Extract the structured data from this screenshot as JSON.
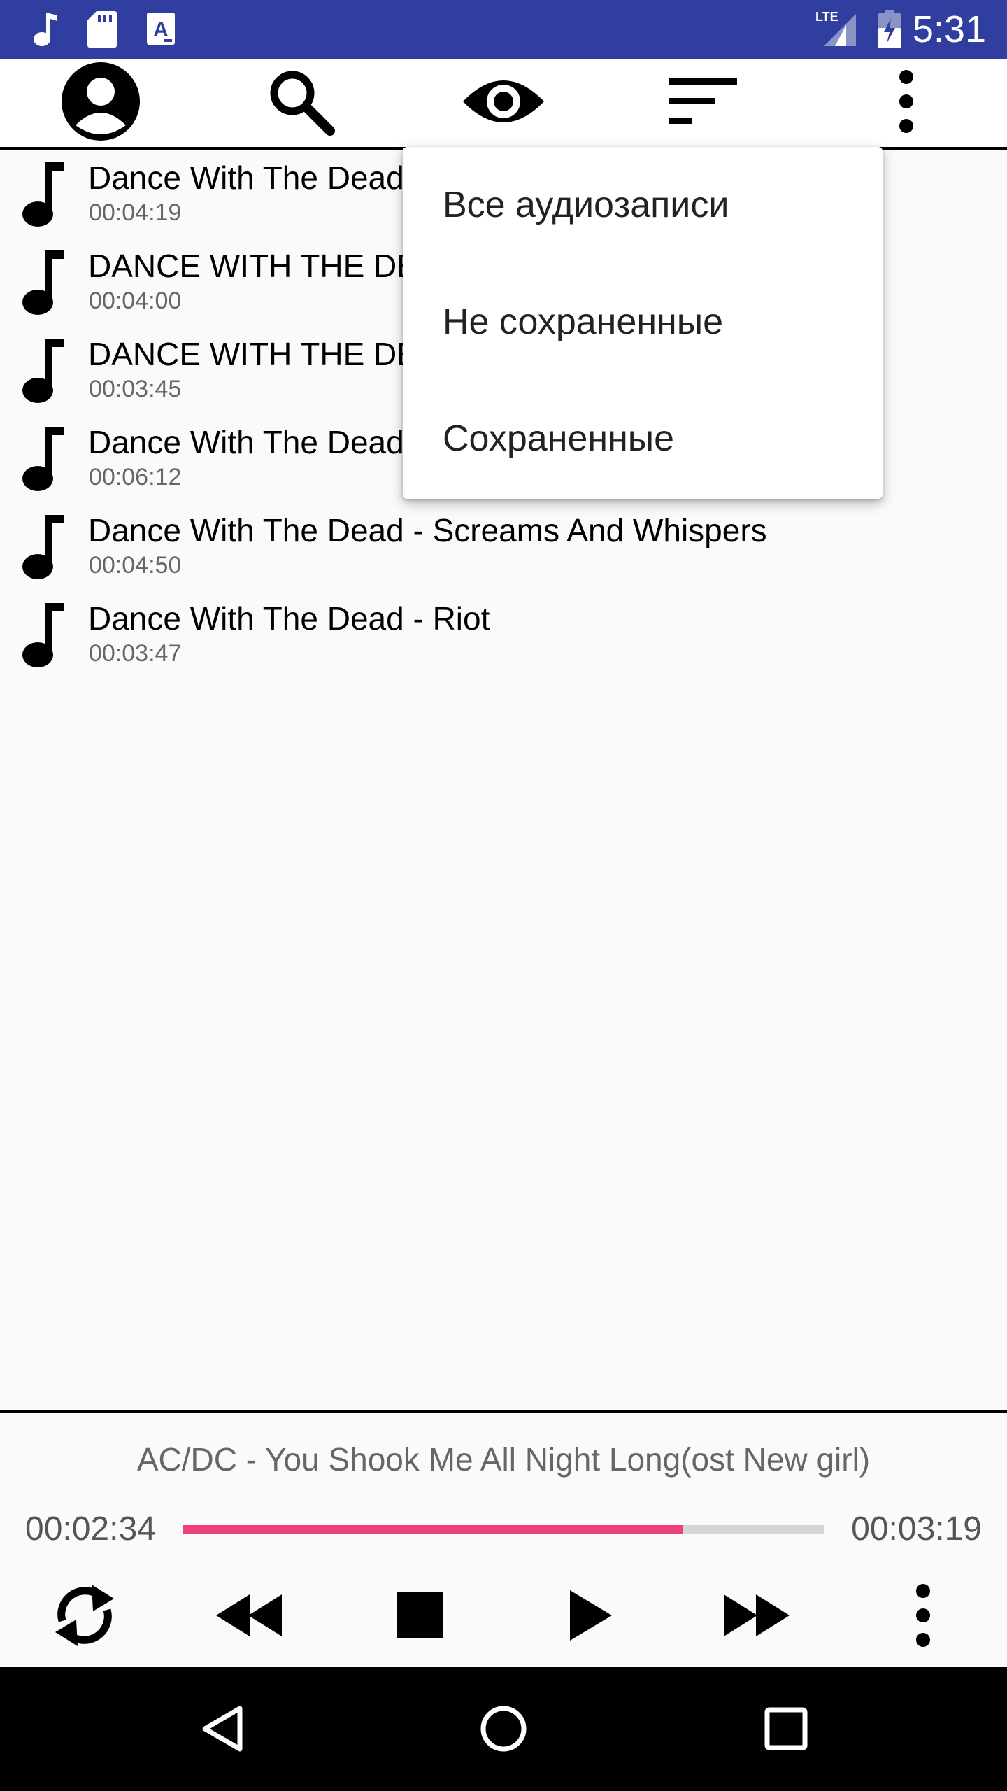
{
  "status_bar": {
    "time": "5:31",
    "network_label": "LTE",
    "left_icons": [
      "music-note-icon",
      "sd-card-icon",
      "keyboard-a-icon"
    ],
    "right_icons": [
      "lte-signal-icon",
      "battery-charging-icon"
    ],
    "background": "#303f9f"
  },
  "toolbar": {
    "icons": [
      "account-icon",
      "search-icon",
      "eye-icon",
      "sort-icon",
      "more-vert-icon"
    ]
  },
  "tracks": [
    {
      "title": "Dance With The Dead",
      "duration": "00:04:19"
    },
    {
      "title": "DANCE WITH THE DE",
      "duration": "00:04:00"
    },
    {
      "title": "DANCE WITH THE DE",
      "duration": "00:03:45"
    },
    {
      "title": "Dance With The Dead",
      "duration": "00:06:12"
    },
    {
      "title": "Dance With The Dead - Screams And Whispers",
      "duration": "00:04:50"
    },
    {
      "title": "Dance With The Dead - Riot",
      "duration": "00:03:47"
    }
  ],
  "filter_menu": {
    "items": [
      "Все аудиозаписи",
      "Не сохраненные",
      "Сохраненные"
    ]
  },
  "player": {
    "now_playing": "AC/DC - You Shook Me All Night Long(ost New girl)",
    "current_time": "00:02:34",
    "total_time": "00:03:19",
    "progress_fraction": 0.78,
    "progress_color": "#ec407a",
    "controls": [
      "repeat-icon",
      "rewind-icon",
      "stop-icon",
      "play-icon",
      "fast-forward-icon",
      "more-vert-icon"
    ]
  },
  "nav_bar": {
    "buttons": [
      "back-icon",
      "home-icon",
      "recents-icon"
    ]
  }
}
